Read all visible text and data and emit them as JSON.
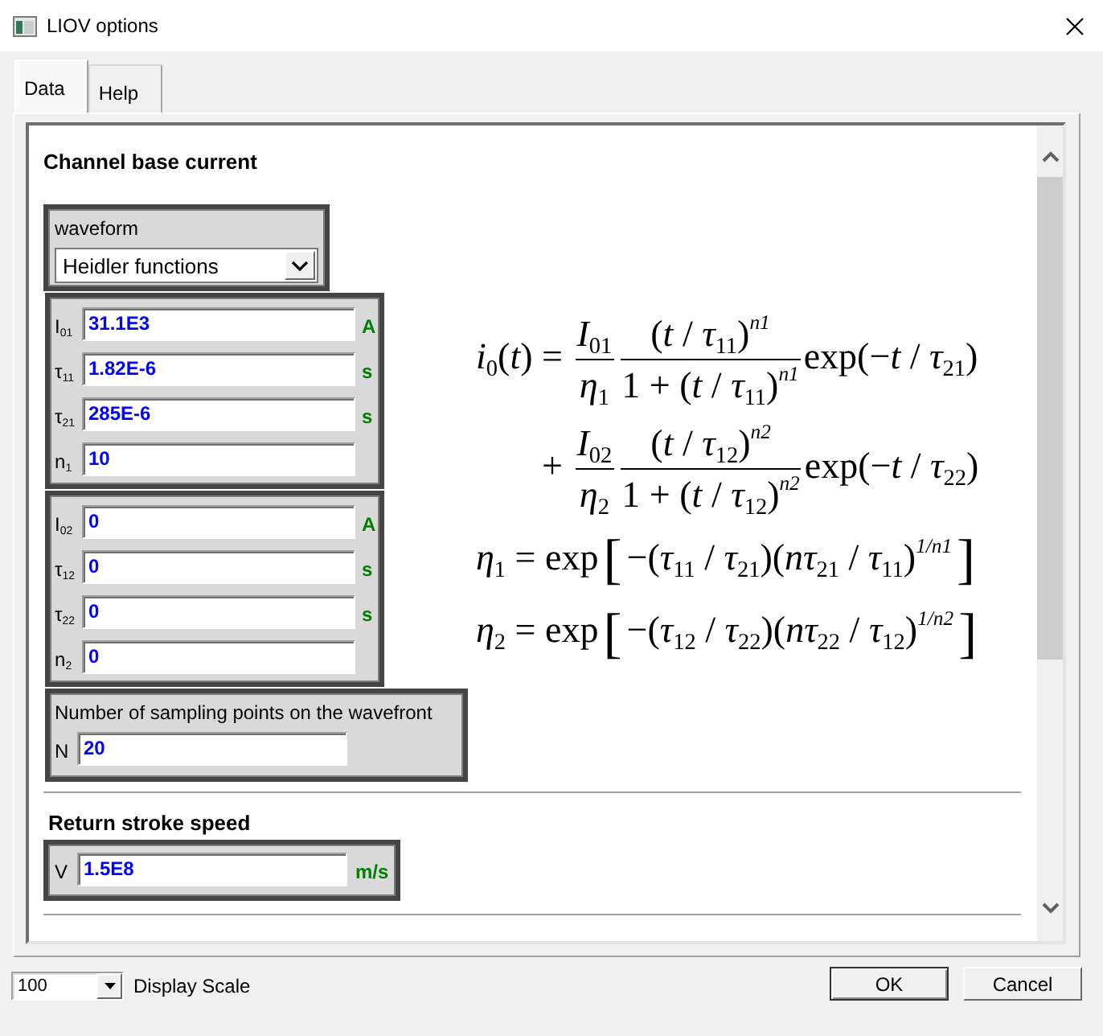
{
  "window": {
    "title": "LIOV options"
  },
  "tabs": [
    {
      "label": "Data",
      "selected": true
    },
    {
      "label": "Help",
      "selected": false
    }
  ],
  "sections": [
    {
      "kind": "channel",
      "heading": "Channel base current",
      "waveform": {
        "label": "waveform",
        "value": "Heidler functions"
      },
      "groups": [
        {
          "fields": [
            {
              "label": "I$_{01}$",
              "value": "31.1E3",
              "unit": "A"
            },
            {
              "label": "τ$_{11}$",
              "value": "1.82E-6",
              "unit": "s"
            },
            {
              "label": "τ$_{21}$",
              "value": "285E-6",
              "unit": "s"
            },
            {
              "label": "n$_{1}$",
              "value": "10"
            }
          ]
        },
        {
          "fields": [
            {
              "label": "I$_{02}$",
              "value": "0",
              "unit": "A"
            },
            {
              "label": "τ$_{12}$",
              "value": "0",
              "unit": "s"
            },
            {
              "label": "τ$_{22}$",
              "value": "0",
              "unit": "s"
            },
            {
              "label": "n$_{2}$",
              "value": "0"
            }
          ]
        }
      ],
      "sampling": {
        "label": "Number of sampling points on the wavefront",
        "fields": [
          {
            "label": "N",
            "value": "20"
          }
        ]
      },
      "formula": {
        "lines": [
          {
            "kind": "equation",
            "tokens": [
              {
                "kind": "text",
                "text": "*i*$_{0}$(*t*) = "
              },
              {
                "kind": "frac",
                "num": [
                  {
                    "kind": "text",
                    "text": "*I*$_{01}$"
                  }
                ],
                "den": [
                  {
                    "kind": "text",
                    "text": "*η*$_{1}$"
                  }
                ]
              },
              {
                "kind": "frac",
                "num": [
                  {
                    "kind": "text",
                    "text": "(*t* / *τ*$_{11}$)$^{n1}$"
                  }
                ],
                "den": [
                  {
                    "kind": "text",
                    "text": "1 + (*t* / *τ*$_{11}$)$^{n1}$"
                  }
                ]
              },
              {
                "kind": "text",
                "text": "exp(−*t* / *τ*$_{21}$)"
              }
            ]
          },
          {
            "kind": "continuation",
            "tokens": [
              {
                "kind": "text",
                "text": "+ "
              },
              {
                "kind": "frac",
                "num": [
                  {
                    "kind": "text",
                    "text": "*I*$_{02}$"
                  }
                ],
                "den": [
                  {
                    "kind": "text",
                    "text": "*η*$_{2}$"
                  }
                ]
              },
              {
                "kind": "frac",
                "num": [
                  {
                    "kind": "text",
                    "text": "(*t* / *τ*$_{12}$)$^{n2}$"
                  }
                ],
                "den": [
                  {
                    "kind": "text",
                    "text": "1 + (*t* / *τ*$_{12}$)$^{n2}$"
                  }
                ]
              },
              {
                "kind": "text",
                "text": "exp(−*t* / *τ*$_{22}$)"
              }
            ]
          },
          {
            "kind": "equation",
            "tokens": [
              {
                "kind": "text",
                "text": "*η*$_{1}$ = exp"
              },
              {
                "kind": "bracket",
                "open": "[",
                "close": "]",
                "body": [
                  {
                    "kind": "text",
                    "text": "−(*τ*$_{11}$ / *τ*$_{21}$)(*nτ*$_{21}$ / *τ*$_{11}$)$^{1/n1}$"
                  }
                ]
              }
            ]
          },
          {
            "kind": "equation",
            "tokens": [
              {
                "kind": "text",
                "text": "*η*$_{2}$ = exp"
              },
              {
                "kind": "bracket",
                "open": "[",
                "close": "]",
                "body": [
                  {
                    "kind": "text",
                    "text": "−(*τ*$_{12}$ / *τ*$_{22}$)(*nτ*$_{22}$ / *τ*$_{12}$)$^{1/n2}$"
                  }
                ]
              }
            ]
          }
        ]
      }
    },
    {
      "kind": "speed",
      "heading": "Return stroke speed",
      "fields": [
        {
          "label": "V",
          "value": "1.5E8",
          "unit": "m/s"
        }
      ]
    }
  ],
  "footer": {
    "scale": {
      "value": "100",
      "label": "Display Scale"
    },
    "buttons": [
      {
        "label": "OK",
        "default": true
      },
      {
        "label": "Cancel",
        "default": false
      }
    ]
  }
}
